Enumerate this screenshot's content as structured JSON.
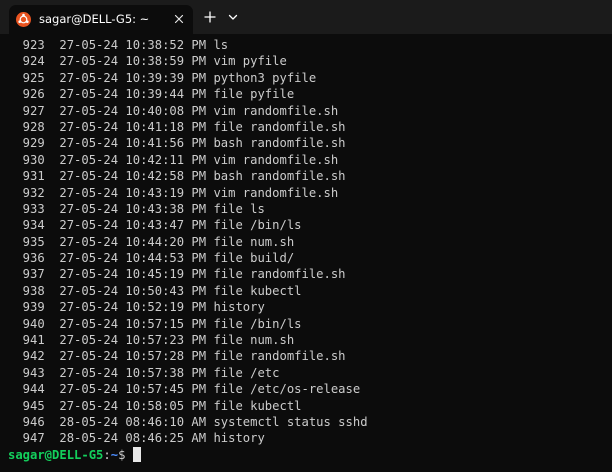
{
  "window": {
    "tab_title": "sagar@DELL-G5: ~",
    "tab_icon": "ubuntu-icon",
    "close_icon": "close-icon",
    "new_tab_icon": "plus-icon",
    "dropdown_icon": "chevron-down-icon",
    "accent_color": "#e95420"
  },
  "terminal": {
    "history": [
      "  923  27-05-24 10:38:52 PM ls",
      "  924  27-05-24 10:38:59 PM vim pyfile",
      "  925  27-05-24 10:39:39 PM python3 pyfile",
      "  926  27-05-24 10:39:44 PM file pyfile",
      "  927  27-05-24 10:40:08 PM vim randomfile.sh",
      "  928  27-05-24 10:41:18 PM file randomfile.sh",
      "  929  27-05-24 10:41:56 PM bash randomfile.sh",
      "  930  27-05-24 10:42:11 PM vim randomfile.sh",
      "  931  27-05-24 10:42:58 PM bash randomfile.sh",
      "  932  27-05-24 10:43:19 PM vim randomfile.sh",
      "  933  27-05-24 10:43:38 PM file ls",
      "  934  27-05-24 10:43:47 PM file /bin/ls",
      "  935  27-05-24 10:44:20 PM file num.sh",
      "  936  27-05-24 10:44:53 PM file build/",
      "  937  27-05-24 10:45:19 PM file randomfile.sh",
      "  938  27-05-24 10:50:43 PM file kubectl",
      "  939  27-05-24 10:52:19 PM history",
      "  940  27-05-24 10:57:15 PM file /bin/ls",
      "  941  27-05-24 10:57:23 PM file num.sh",
      "  942  27-05-24 10:57:28 PM file randomfile.sh",
      "  943  27-05-24 10:57:38 PM file /etc",
      "  944  27-05-24 10:57:45 PM file /etc/os-release",
      "  945  27-05-24 10:58:05 PM file kubectl",
      "  946  28-05-24 08:46:10 AM systemctl status sshd",
      "  947  28-05-24 08:46:25 AM history"
    ],
    "prompt": {
      "user_host": "sagar@DELL-G5",
      "separator": ":",
      "path": "~",
      "symbol": "$ "
    },
    "colors": {
      "background": "#0c0c0c",
      "foreground": "#cccccc",
      "prompt_user": "#13d05c",
      "prompt_path": "#4c8dff"
    }
  }
}
